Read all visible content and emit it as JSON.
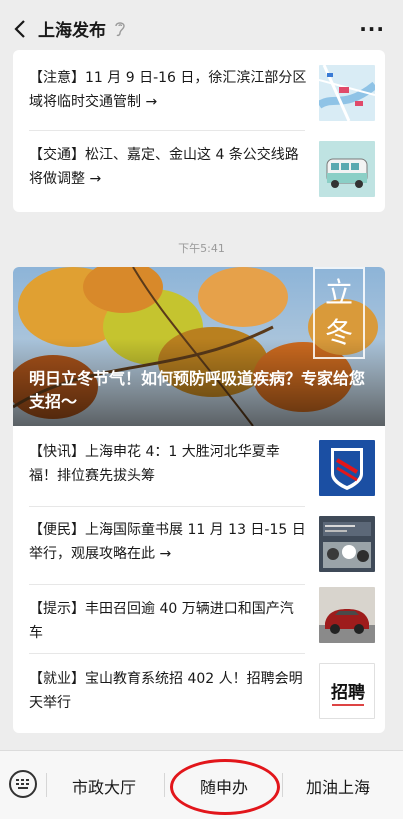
{
  "header": {
    "title": "上海发布",
    "back_icon": "back-arrow-icon",
    "more_label": "···",
    "listen_icon": "ear-icon"
  },
  "card1": {
    "items": [
      {
        "text": "【注意】11 月 9 日-16 日，徐汇滨江部分区域将临时交通管制 →",
        "thumb": "map-thumbnail"
      },
      {
        "text": "【交通】松江、嘉定、金山这 4 条公交线路将做调整 →",
        "thumb": "bus-thumbnail"
      }
    ]
  },
  "timestamp": "下午5:41",
  "card2": {
    "cover_title": "明日立冬节气！如何预防呼吸道疾病？专家给您支招～",
    "badge_text": [
      "立",
      "冬"
    ],
    "items": [
      {
        "text": "【快讯】上海申花 4：1 大胜河北华夏幸福！排位赛先拔头筹",
        "thumb": "shenhua-logo-thumbnail"
      },
      {
        "text": "【便民】上海国际童书展 11 月 13 日-15 日举行，观展攻略在此 →",
        "thumb": "book-fair-thumbnail"
      },
      {
        "text": "【提示】丰田召回逾 40 万辆进口和国产汽车",
        "thumb": "car-thumbnail"
      },
      {
        "text": "【就业】宝山教育系统招 402 人！招聘会明天举行",
        "thumb": "recruit-thumbnail",
        "thumb_text": "招聘"
      }
    ]
  },
  "bottom_menu": {
    "keyboard_icon": "keyboard-icon",
    "items": [
      "市政大厅",
      "随申办",
      "加油上海"
    ],
    "highlight_color": "#e2161b"
  }
}
